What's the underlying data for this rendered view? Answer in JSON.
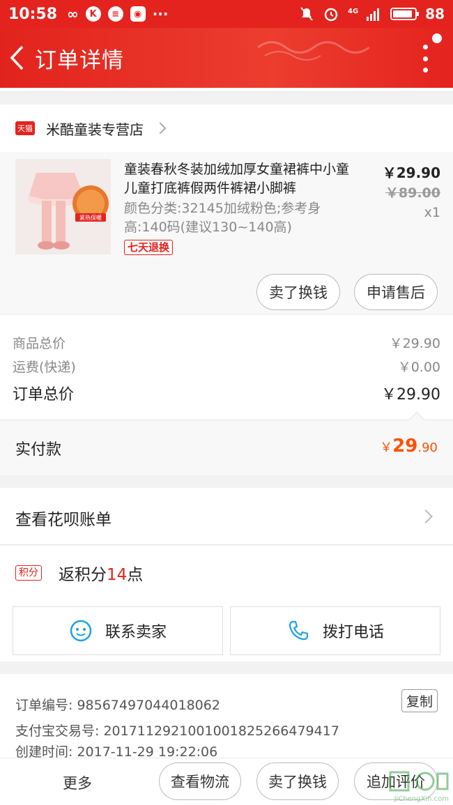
{
  "status_bar": {
    "time": "10:58",
    "battery": "88",
    "network": "4G"
  },
  "header": {
    "title": "订单详情"
  },
  "shop": {
    "badge": "天猫",
    "name": "米酷童装专营店"
  },
  "item": {
    "title": "童装春秋冬装加绒加厚女童裙裤中小童儿童打底裤假两件裤裙小脚裤",
    "spec": "颜色分类:32145加绒粉色;参考身高:140码(建议130~140高)",
    "return_tag": "七天退换",
    "price": "￥29.90",
    "original_price": "￥89.00",
    "quantity": "x1",
    "image_badge": "紧热保暖",
    "sell_label": "卖了换钱",
    "aftersale_label": "申请售后"
  },
  "summary": {
    "goods_total_label": "商品总价",
    "goods_total": "￥29.90",
    "shipping_label": "运费(快递)",
    "shipping": "￥0.00",
    "order_total_label": "订单总价",
    "order_total": "￥29.90",
    "paid_label": "实付款",
    "paid_currency": "￥",
    "paid_int": "29",
    "paid_dec": ".90"
  },
  "huabei": {
    "label": "查看花呗账单"
  },
  "points": {
    "tag": "积分",
    "prefix": "返积分",
    "value": "14",
    "suffix": "点"
  },
  "contact": {
    "seller_label": "联系卖家",
    "call_label": "拨打电话"
  },
  "order_meta": {
    "order_no": "订单编号: 98567497044018062",
    "alipay_no": "支付宝交易号: 2017112921001001825266479417",
    "created": "创建时间: 2017-11-29 19:22:06",
    "copy_label": "复制"
  },
  "bottom_bar": {
    "more_label": "更多",
    "logistics_label": "查看物流",
    "sell_label": "卖了换钱",
    "review_label": "追加评价"
  },
  "watermark": {
    "text": "JiChengXin.com"
  },
  "colors": {
    "brand_red": "#e4231e",
    "price_orange": "#ff5000",
    "link_blue": "#1aa1e8"
  }
}
